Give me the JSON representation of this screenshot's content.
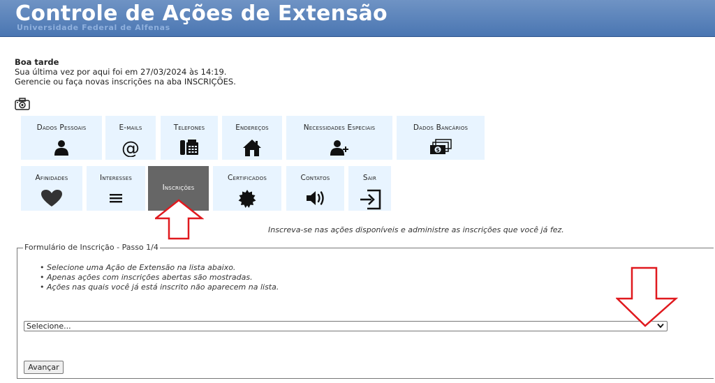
{
  "header": {
    "title": "Controle de Ações de Extensão",
    "subtitle": "Universidade Federal de Alfenas"
  },
  "greeting": {
    "hello": "Boa tarde",
    "last_visit": "Sua última vez por aqui foi em 27/03/2024 às 14:19.",
    "instruction": "Gerencie ou faça novas inscrições na aba INSCRIÇÕES."
  },
  "tiles": [
    {
      "label": "Dados Pessoais",
      "icon": "person-icon"
    },
    {
      "label": "E-mails",
      "icon": "at-icon"
    },
    {
      "label": "Telefones",
      "icon": "fax-phone-icon"
    },
    {
      "label": "Endereços",
      "icon": "home-icon"
    },
    {
      "label": "Necessidades Especiais",
      "icon": "person-plus-icon"
    },
    {
      "label": "Dados Bancários",
      "icon": "money-icon"
    },
    {
      "label": "Afinidades",
      "icon": "heart-icon"
    },
    {
      "label": "Interesses",
      "icon": "menu-icon"
    },
    {
      "label": "Inscrições",
      "icon": "none",
      "active": true
    },
    {
      "label": "Certificados",
      "icon": "seal-icon"
    },
    {
      "label": "Contatos",
      "icon": "speaker-icon"
    },
    {
      "label": "Sair",
      "icon": "logout-icon"
    }
  ],
  "hint": "Inscreva-se nas ações disponíveis e administre as inscrições que você já fez.",
  "form": {
    "legend": "Formulário de Inscrição - Passo 1/4",
    "instructions": [
      "Selecione uma Ação de Extensão na lista abaixo.",
      "Apenas ações com inscrições abertas são mostradas.",
      "Ações nas quais você já está inscrito não aparecem na lista."
    ],
    "select_value": "Selecione...",
    "submit_label": "Avançar"
  },
  "colors": {
    "header_bg": "#5a82bb",
    "tile_bg": "#e8f4ff",
    "tile_active_bg": "#666666",
    "annotation_arrow": "#e0191e"
  }
}
